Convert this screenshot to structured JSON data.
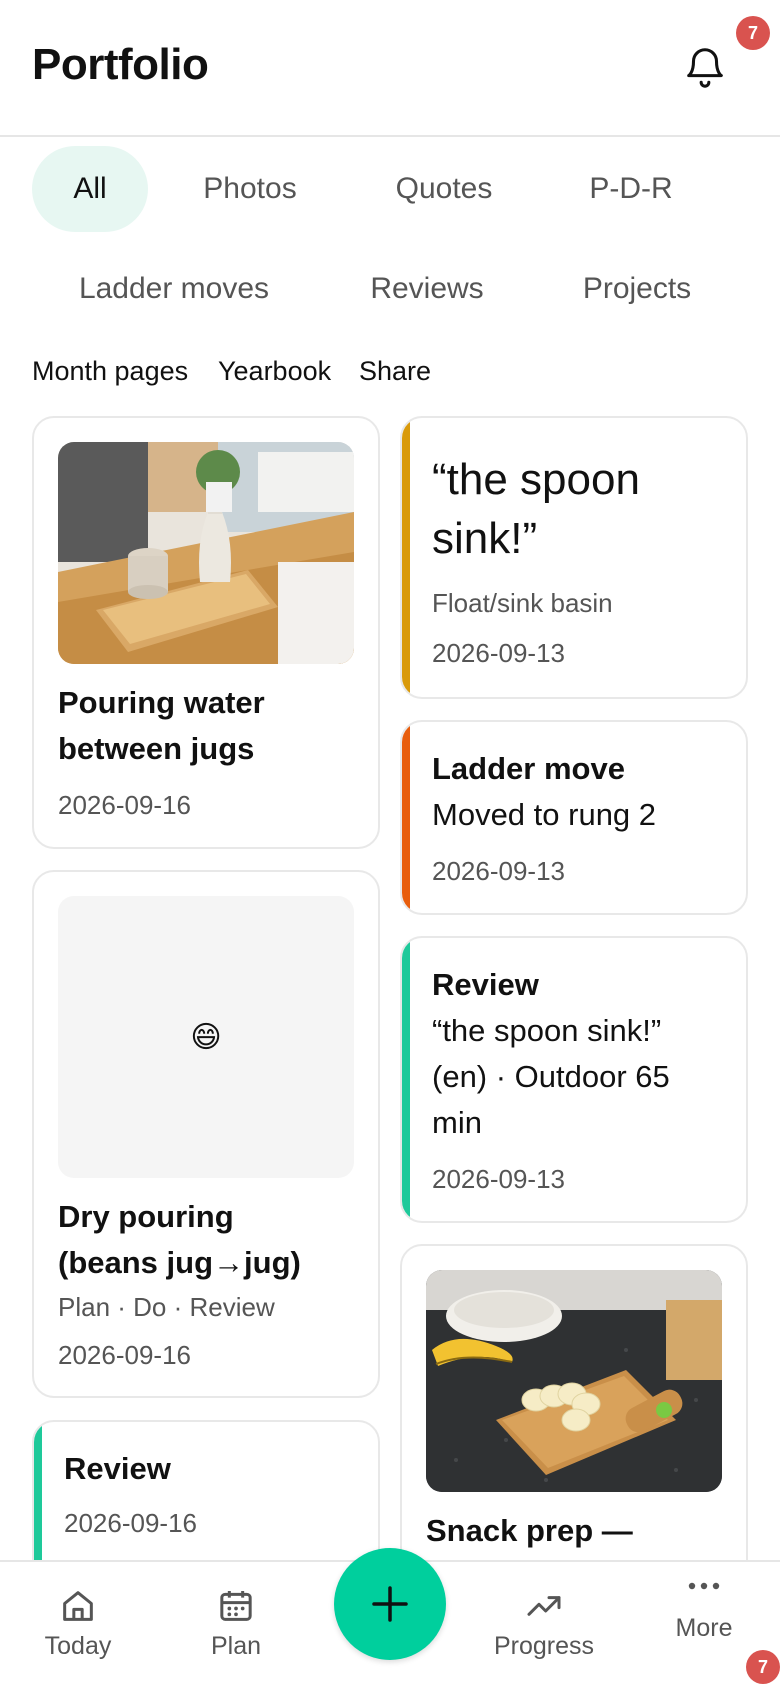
{
  "header": {
    "title": "Portfolio",
    "notification_count": "7"
  },
  "filters": [
    "All",
    "Photos",
    "Quotes",
    "P-D-R",
    "Ladder moves",
    "Reviews",
    "Projects"
  ],
  "links": [
    "Month pages",
    "Yearbook",
    "Share"
  ],
  "colors": {
    "accent": "#00cf9d",
    "quote_accent": "#d99a0a",
    "ladder_accent": "#e85d0c",
    "review_accent": "#1ec99a",
    "badge": "#d9534f"
  },
  "cards": {
    "pouring": {
      "title_line1": "Pouring water",
      "title_line2": "between jugs",
      "date": "2026-09-16"
    },
    "quote": {
      "line1": "“the spoon",
      "line2": "sink!”",
      "source": "Float/sink basin",
      "date": "2026-09-13"
    },
    "ladder": {
      "title": "Ladder move",
      "text": "Moved to rung 2",
      "date": "2026-09-13"
    },
    "review1": {
      "title": "Review",
      "line1": "“the spoon sink!”",
      "line2": "(en) · Outdoor 65",
      "line3": "min",
      "date": "2026-09-13"
    },
    "dry": {
      "emoji": "😄",
      "title_line1": "Dry pouring",
      "title_line2": "(beans jug→jug)",
      "tags": "Plan · Do · Review",
      "date": "2026-09-16"
    },
    "review2": {
      "title": "Review",
      "date": "2026-09-16"
    },
    "snack": {
      "title": "Snack prep —"
    }
  },
  "nav": {
    "today": {
      "label": "Today",
      "icon": "home-icon"
    },
    "plan": {
      "label": "Plan",
      "icon": "calendar-icon"
    },
    "add": {
      "icon": "plus-icon"
    },
    "progress": {
      "label": "Progress",
      "icon": "trend-icon"
    },
    "more": {
      "label": "More",
      "icon": "more-dots-icon",
      "badge": "7"
    }
  }
}
